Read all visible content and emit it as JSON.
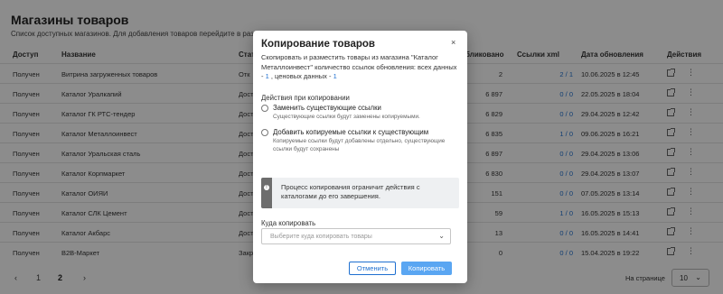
{
  "page": {
    "title": "Магазины товаров",
    "subtitle": "Список доступных магазинов. Для добавления товаров перейдите в раздел"
  },
  "table": {
    "headers": {
      "access": "Доступ",
      "name": "Название",
      "status": "Стат",
      "published": "бликовано",
      "links": "Ссылки xml",
      "date": "Дата обновления",
      "actions": "Действия"
    },
    "rows": [
      {
        "access": "Получен",
        "name": "Витрина загруженных товаров",
        "status": "Отк",
        "published": "2",
        "links": "2 / 1",
        "date": "10.06.2025 в 12:45"
      },
      {
        "access": "Получен",
        "name": "Каталог Уралкапий",
        "status": "Дост",
        "published": "6 897",
        "links": "0 / 0",
        "date": "22.05.2025 в 18:04"
      },
      {
        "access": "Получен",
        "name": "Каталог ГК РТС-тендер",
        "status": "Дост",
        "published": "6 829",
        "links": "0 / 0",
        "date": "29.04.2025 в 12:42"
      },
      {
        "access": "Получен",
        "name": "Каталог Металлоинвест",
        "status": "Дост",
        "published": "6 835",
        "links": "1 / 0",
        "date": "09.06.2025 в 16:21"
      },
      {
        "access": "Получен",
        "name": "Каталог Уральская сталь",
        "status": "Дост",
        "published": "6 897",
        "links": "0 / 0",
        "date": "29.04.2025 в 13:06"
      },
      {
        "access": "Получен",
        "name": "Каталог Корпмаркет",
        "status": "Дост",
        "published": "6 830",
        "links": "0 / 0",
        "date": "29.04.2025 в 13:07"
      },
      {
        "access": "Получен",
        "name": "Каталог ОИЯИ",
        "status": "Дост",
        "published": "151",
        "links": "0 / 0",
        "date": "07.05.2025 в 13:14"
      },
      {
        "access": "Получен",
        "name": "Каталог СЛК Цемент",
        "status": "Дост",
        "published": "59",
        "links": "1 / 0",
        "date": "16.05.2025 в 15:13"
      },
      {
        "access": "Получен",
        "name": "Каталог Акбарс",
        "status": "Дост",
        "published": "13",
        "links": "0 / 0",
        "date": "16.05.2025 в 14:41"
      },
      {
        "access": "Получен",
        "name": "B2B-Маркет",
        "status": "Закр",
        "published": "0",
        "links": "0 / 0",
        "date": "15.04.2025 в 19:22"
      }
    ]
  },
  "pagination": {
    "prev": "‹",
    "pages": [
      "1",
      "2"
    ],
    "current": "2",
    "next": "›",
    "per_page_label": "На странице",
    "per_page_value": "10"
  },
  "modal": {
    "title": "Копирование товаров",
    "close": "×",
    "desc_text": "Скопировать и разместить товары из магазина \"Каталог Металлоинвест\" количество ссылок обновления: всех данных - ",
    "desc_all": "1",
    "desc_mid": " , ценовых данных - ",
    "desc_price": "1",
    "actions_label": "Действия при копировании",
    "option_replace": "Заменить существующие ссылки",
    "option_replace_help": "Существующие ссылки будут заменены копируемыми.",
    "option_add": "Добавить копируемые ссылки к существующим",
    "option_add_help": "Копируемые ссылки будут добавлены отдельно, существующие ссылки будут сохранены",
    "warning": "Процесс копирования ограничит действия с каталогами до его завершения.",
    "dest_label": "Куда копировать",
    "dest_placeholder": "Выберите куда копировать товары",
    "cancel": "Отменить",
    "copy": "Копировать"
  },
  "icons": {
    "subtitle": "external-link-icon",
    "row_open": "external-link-icon",
    "row_more": "more-vertical-icon",
    "warning": "info-icon",
    "select": "chevron-down-icon"
  },
  "colors": {
    "accent": "#1e6fd0",
    "primary_button": "#5aa6f2",
    "overlay": "rgba(0,0,0,0.45)"
  }
}
